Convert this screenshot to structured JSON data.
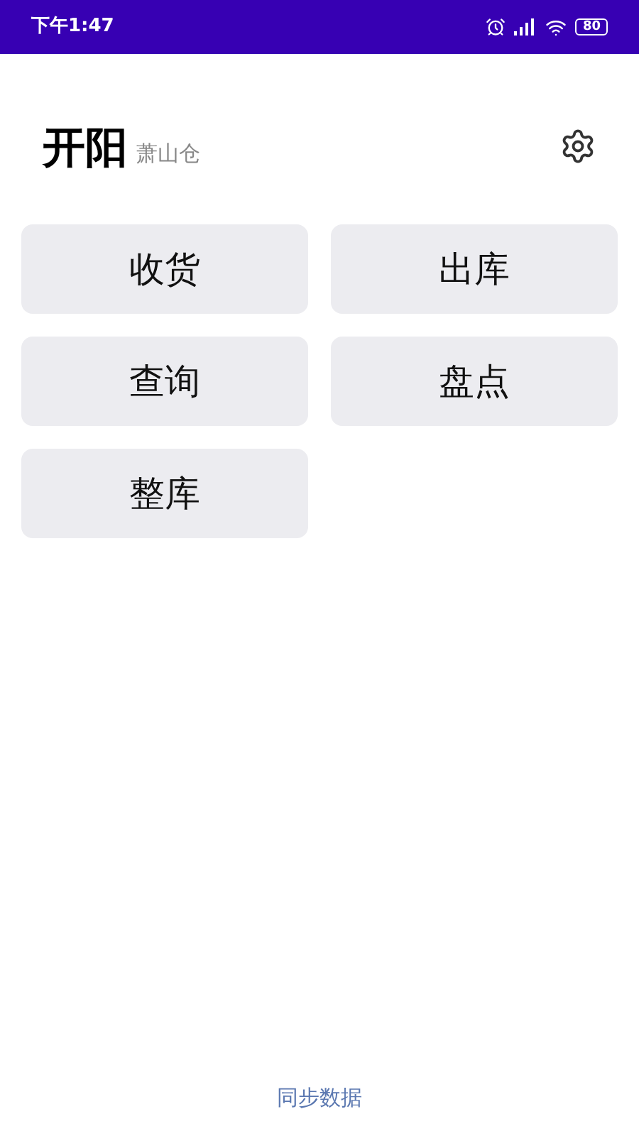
{
  "status_bar": {
    "time": "下午1:47",
    "battery": "80"
  },
  "header": {
    "title": "开阳",
    "subtitle": "萧山仓"
  },
  "actions": [
    {
      "label": "收货"
    },
    {
      "label": "出库"
    },
    {
      "label": "查询"
    },
    {
      "label": "盘点"
    },
    {
      "label": "整库"
    }
  ],
  "footer": {
    "link": "同步数据"
  }
}
